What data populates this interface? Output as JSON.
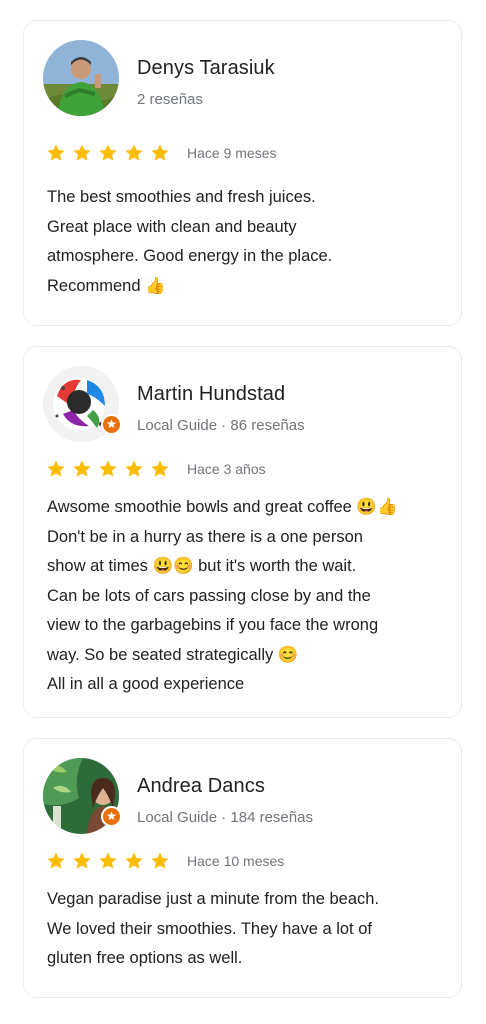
{
  "reviews": [
    {
      "name": "Denys Tarasiuk",
      "meta": "2 reseñas",
      "rating": 5,
      "date": "Hace 9 meses",
      "lines": [
        "The best smoothies and fresh juices.",
        "Great place with clean and beauty",
        "atmosphere. Good energy in the place.",
        "Recommend 👍"
      ],
      "local_guide": false
    },
    {
      "name": "Martin Hundstad",
      "meta": "Local Guide · 86 reseñas",
      "rating": 5,
      "date": "Hace 3 años",
      "lines": [
        "Awsome smoothie bowls and great coffee 😃👍",
        "Don't be in a hurry as there is a one person",
        "show at times 😃😊 but it's worth the wait.",
        "Can be lots of cars passing close by and the",
        "view to the garbagebins if you face the wrong",
        "way. So be seated strategically 😊",
        "All in all a good experience"
      ],
      "local_guide": true
    },
    {
      "name": "Andrea Dancs",
      "meta": "Local Guide · 184 reseñas",
      "rating": 5,
      "date": "Hace 10 meses",
      "lines": [
        "Vegan paradise just a minute from the beach.",
        "We loved their smoothies. They have a lot of",
        "gluten free options as well."
      ],
      "local_guide": true
    }
  ],
  "colors": {
    "star": "#fbbc04",
    "local_guide_badge": "#e8710a",
    "meta_text": "#70757a"
  },
  "icons": {
    "star": "star-icon",
    "badge": "local-guide-badge-icon"
  }
}
